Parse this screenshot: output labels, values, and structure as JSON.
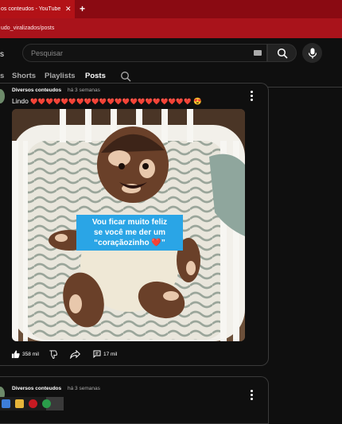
{
  "browser": {
    "tab_title": "os conteudos - YouTube",
    "tab_close": "✕",
    "new_tab": "+",
    "url": "udo_viralizados/posts"
  },
  "header": {
    "search_placeholder": "Pesquisar"
  },
  "channel_tabs": [
    {
      "label": "s"
    },
    {
      "label": "Shorts"
    },
    {
      "label": "Playlists"
    },
    {
      "label": "Posts",
      "active": true
    }
  ],
  "post": {
    "channel": "Diversos conteudos",
    "time": "há 3 semanas",
    "text_lead": "Lindo",
    "text_hearts": "❤️❤️❤️❤️❤️❤️❤️❤️❤️❤️❤️❤️❤️❤️❤️❤️❤️❤️❤️❤️❤️",
    "text_tail": "😍",
    "image_caption": [
      "Vou ficar muito feliz",
      "se você me der um",
      "“coraçãozinho ❤️”"
    ],
    "likes": "358 mil",
    "comments": "17 mil"
  },
  "post2": {
    "channel": "Diversos conteudos",
    "time": "há 3 semanas"
  },
  "colors": {
    "youtube_red": "#b31217",
    "caption_blue": "#2aa5e6",
    "heart_red": "#e0242b"
  }
}
